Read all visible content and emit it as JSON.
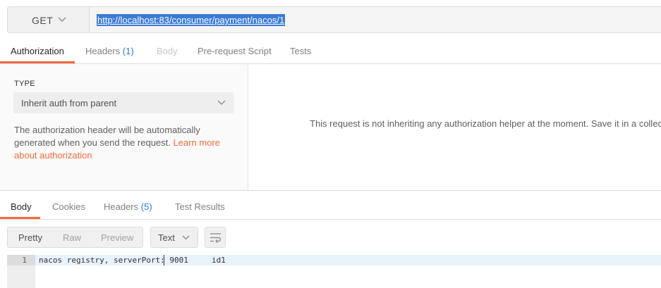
{
  "request": {
    "method": "GET",
    "url": "http://localhost:83/consumer/payment/nacos/1"
  },
  "request_tabs": [
    {
      "label": "Authorization",
      "count": ""
    },
    {
      "label": "Headers",
      "count": "(1)"
    },
    {
      "label": "Body",
      "count": ""
    },
    {
      "label": "Pre-request Script",
      "count": ""
    },
    {
      "label": "Tests",
      "count": ""
    }
  ],
  "auth": {
    "type_label": "TYPE",
    "type_value": "Inherit auth from parent",
    "description": "The authorization header will be automatically generated when you send the request.",
    "learn_more": "Learn more about authorization",
    "message": "This request is not inheriting any authorization helper at the moment. Save it in a collection"
  },
  "response_tabs": [
    {
      "label": "Body",
      "count": ""
    },
    {
      "label": "Cookies",
      "count": ""
    },
    {
      "label": "Headers",
      "count": "(5)"
    },
    {
      "label": "Test Results",
      "count": ""
    }
  ],
  "response_toolbar": {
    "views": [
      "Pretty",
      "Raw",
      "Preview"
    ],
    "format": "Text"
  },
  "response_body": {
    "line_number": "1",
    "content": "nacos registry, serverPort: 9001     id1"
  },
  "colors": {
    "accent": "#f26b3a",
    "count_blue": "#2b7bd6",
    "selection": "#3a7bd5"
  }
}
